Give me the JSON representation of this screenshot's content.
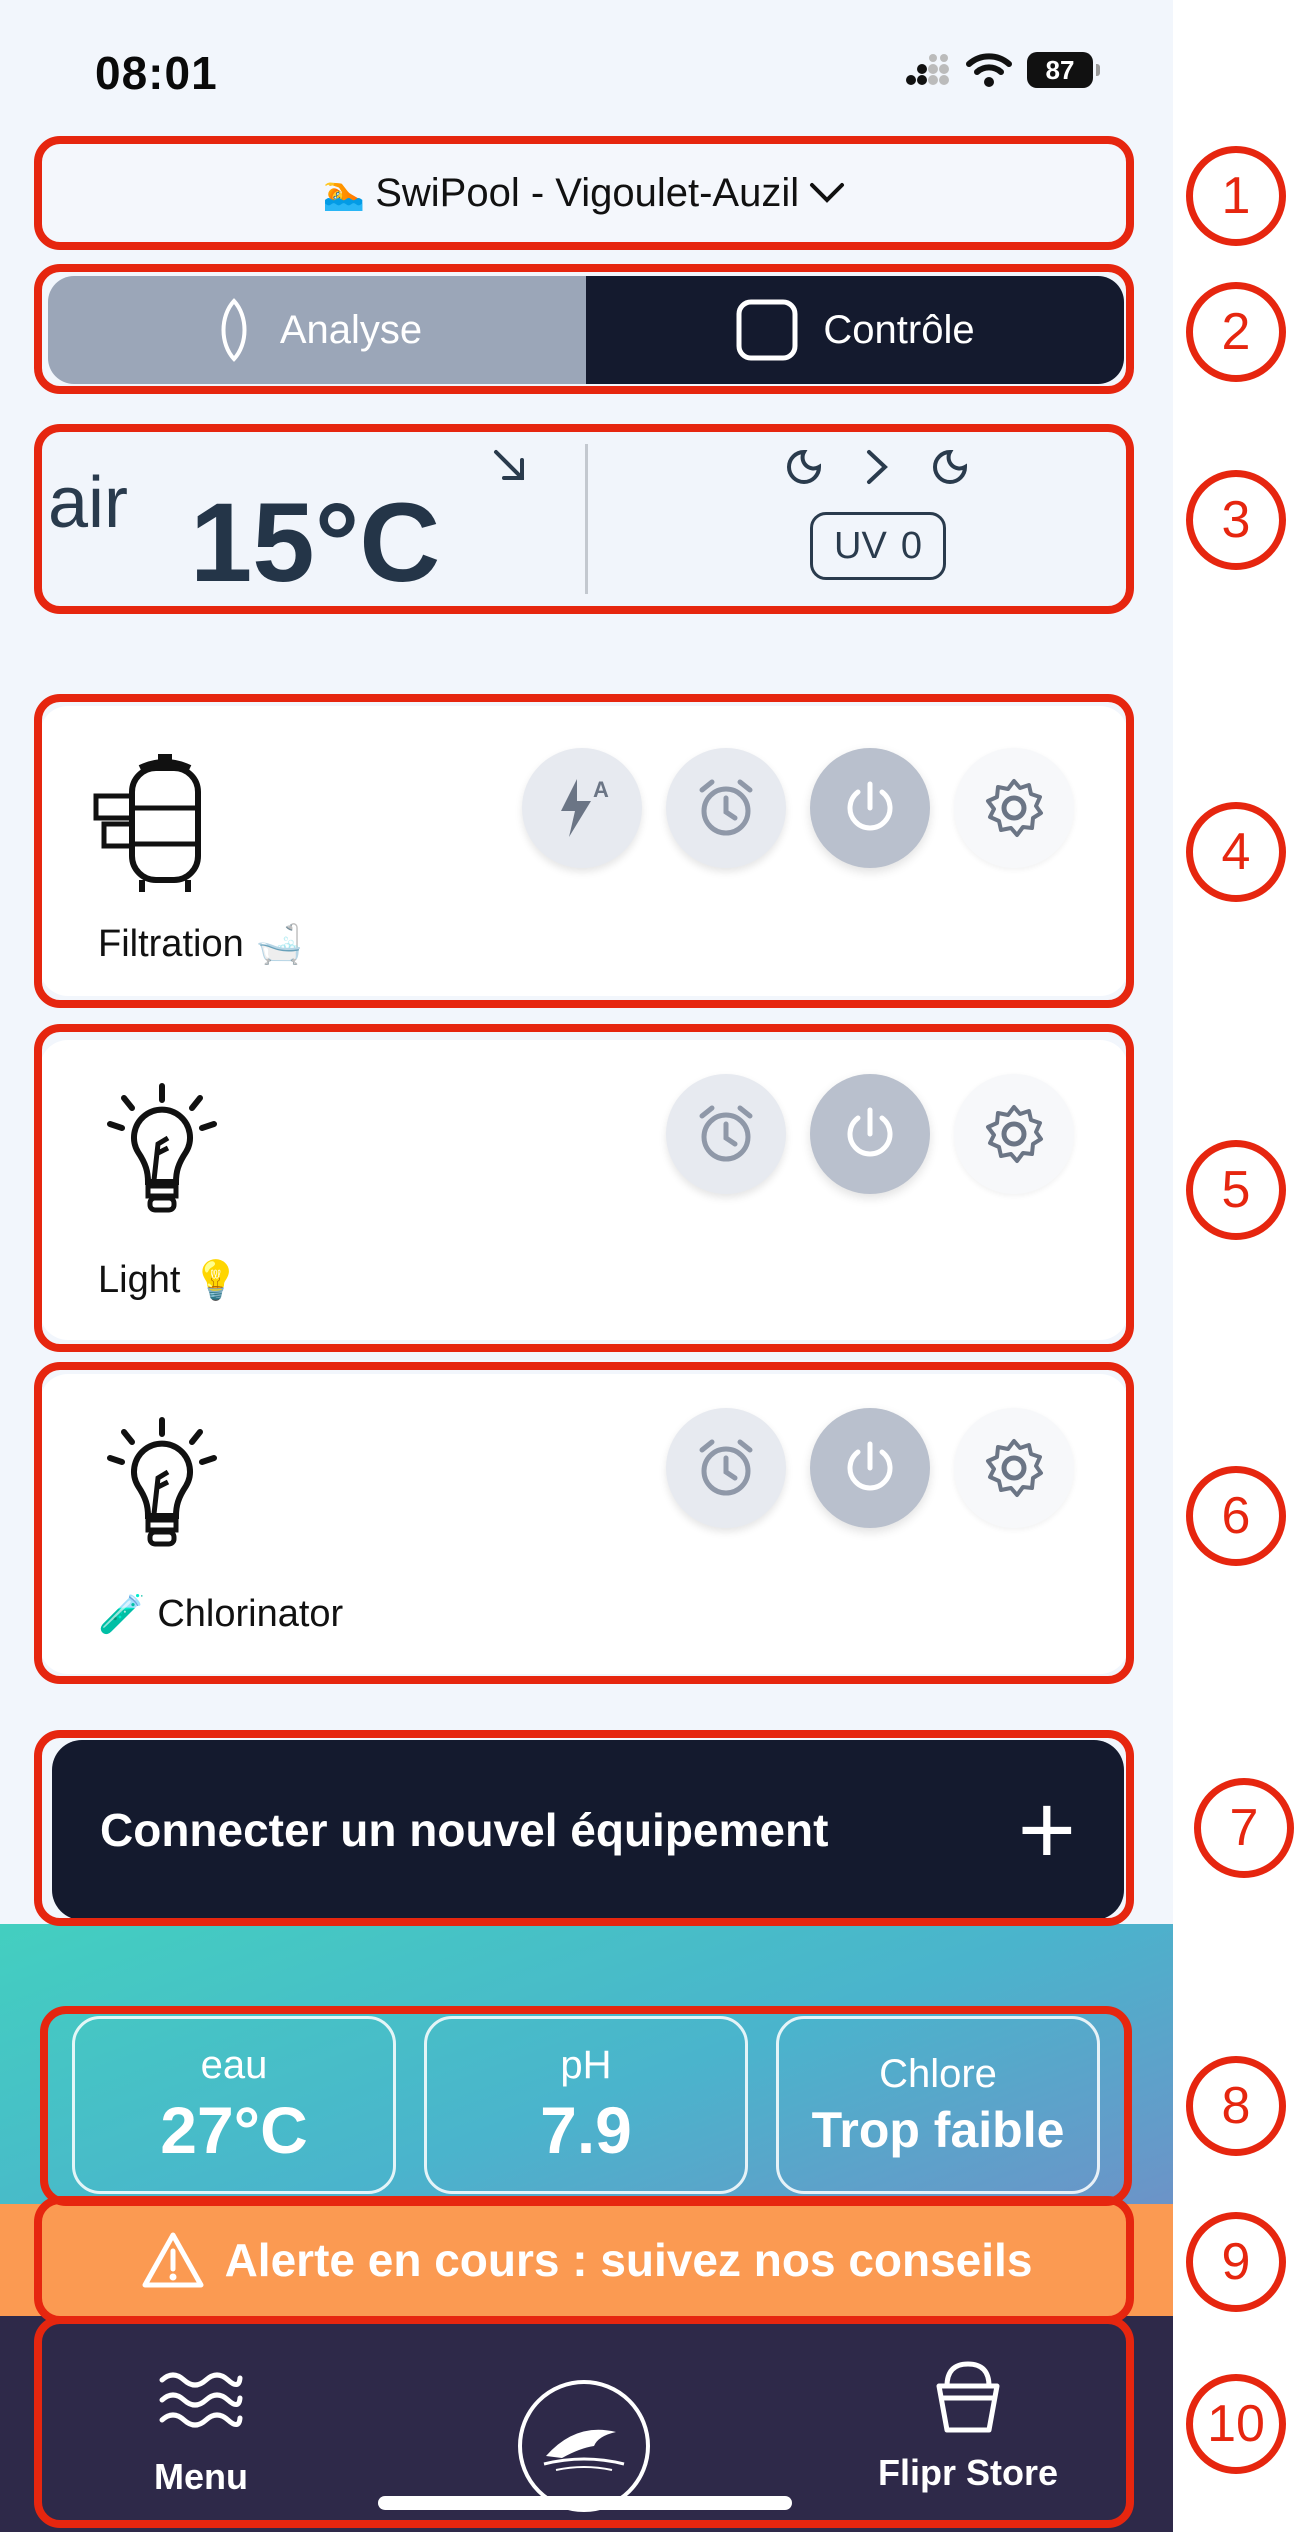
{
  "status_bar": {
    "time": "08:01",
    "battery": "87"
  },
  "pool_selector": {
    "emoji": "🏊",
    "label": "SwiPool - Vigoulet-Auzil"
  },
  "tabs": [
    {
      "label": "Analyse"
    },
    {
      "label": "Contrôle"
    }
  ],
  "weather": {
    "air_label": "air",
    "temperature": "15°C",
    "uv_label": "UV",
    "uv_value": "0"
  },
  "equipment": [
    {
      "name": "Filtration",
      "emoji": "🛁"
    },
    {
      "name": "Light",
      "emoji": "💡"
    },
    {
      "name": "Chlorinator",
      "emoji": "🧪"
    }
  ],
  "connect_button": {
    "label": "Connecter un nouvel équipement",
    "plus": "+"
  },
  "metrics": [
    {
      "label": "eau",
      "value": "27°C"
    },
    {
      "label": "pH",
      "value": "7.9"
    },
    {
      "label": "Chlore",
      "value": "Trop faible"
    }
  ],
  "alert": {
    "text": "Alerte en cours : suivez nos conseils"
  },
  "nav": {
    "menu_label": "Menu",
    "store_label": "Flipr Store"
  },
  "annotations": [
    "1",
    "2",
    "3",
    "4",
    "5",
    "6",
    "7",
    "8",
    "9",
    "10"
  ],
  "colors": {
    "annotation": "#e6260f",
    "dark": "#141a2e",
    "alert": "#fb9a52",
    "nav": "#2e2949"
  }
}
